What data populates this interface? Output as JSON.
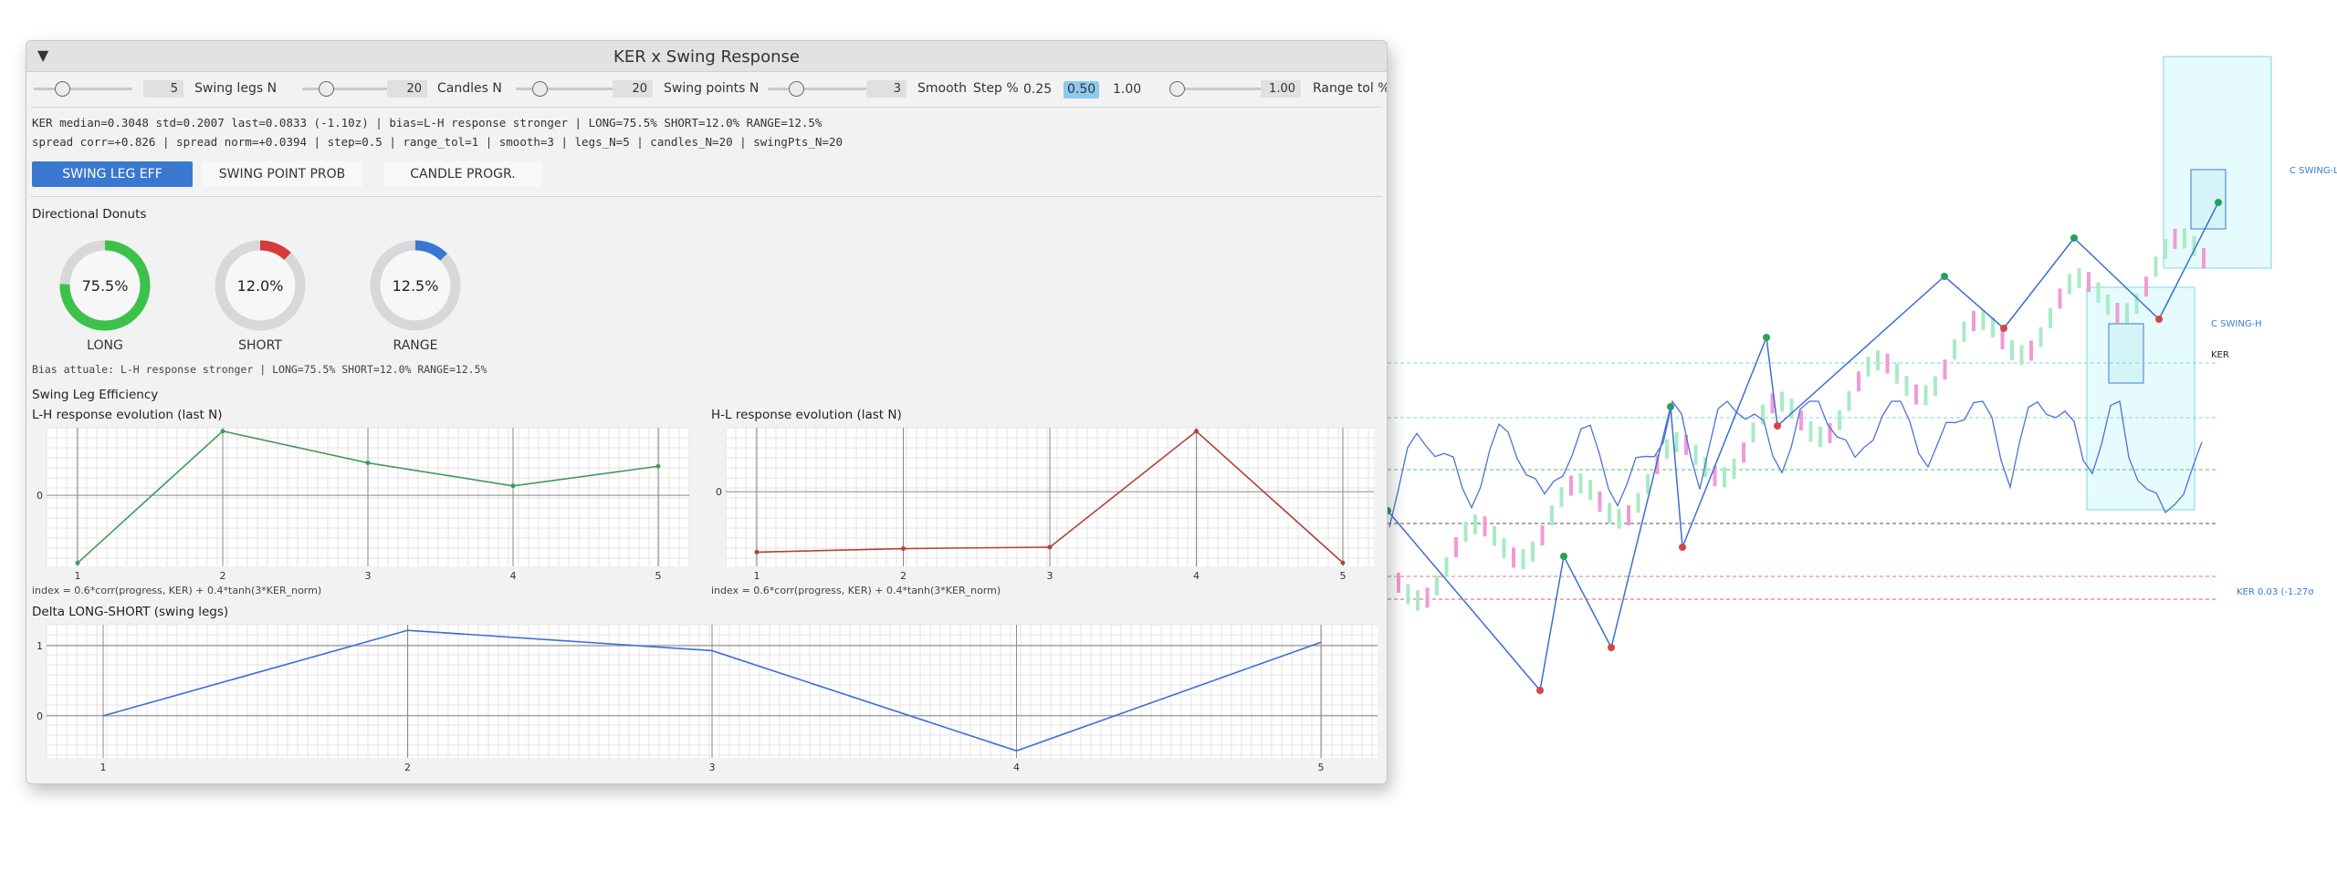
{
  "window": {
    "title": "KER x Swing Response",
    "collapse_icon": "▼"
  },
  "controls": {
    "swing_legs": {
      "value": "5",
      "label": "Swing legs N",
      "slider_pos": 0.25
    },
    "candles": {
      "value": "20",
      "label": "Candles N",
      "slider_pos": 0.2
    },
    "swing_points": {
      "value": "20",
      "label": "Swing points N",
      "slider_pos": 0.2
    },
    "smooth": {
      "value": "3",
      "label": "Smooth",
      "slider_pos": 0.25
    },
    "step": {
      "label": "Step %",
      "options": [
        "0.25",
        "0.50",
        "1.00"
      ],
      "selected": "0.50"
    },
    "range_tol": {
      "value": "1.00",
      "label": "Range tol %",
      "slider_pos": 0.0
    }
  },
  "stats": {
    "line1": "KER median=0.3048 std=0.2007 last=0.0833 (-1.10z) | bias=L-H response stronger | LONG=75.5% SHORT=12.0% RANGE=12.5%",
    "line2": "spread corr=+0.826 | spread norm=+0.0394 | step=0.5 | range_tol=1 | smooth=3 | legs_N=5 | candles_N=20 | swingPts_N=20"
  },
  "tabs": [
    {
      "label": "SWING LEG EFF",
      "active": true
    },
    {
      "label": "SWING POINT PROB",
      "active": false
    },
    {
      "label": "CANDLE PROGR.",
      "active": false
    }
  ],
  "donuts": {
    "title": "Directional Donuts",
    "items": [
      {
        "label": "LONG",
        "value": 75.5,
        "text": "75.5%",
        "color": "#3cc24a"
      },
      {
        "label": "SHORT",
        "value": 12.0,
        "text": "12.0%",
        "color": "#d63a3a"
      },
      {
        "label": "RANGE",
        "value": 12.5,
        "text": "12.5%",
        "color": "#3a78d0"
      }
    ],
    "bias_text": "Bias attuale: L-H response stronger | LONG=75.5% SHORT=12.0% RANGE=12.5%"
  },
  "section_title": "Swing Leg Efficiency",
  "chart_data": [
    {
      "type": "line",
      "title": "L-H response evolution (last N)",
      "x": [
        1,
        2,
        3,
        4,
        5
      ],
      "series": [
        {
          "values": [
            -1.0,
            0.95,
            0.48,
            0.14,
            0.43
          ],
          "color": "#3f9a55"
        }
      ],
      "ylim": [
        -1.05,
        1.0
      ],
      "zero_label": "0",
      "footnote": "index = 0.6*corr(progress, KER) + 0.4*tanh(3*KER_norm)"
    },
    {
      "type": "line",
      "title": "H-L response evolution (last N)",
      "x": [
        1,
        2,
        3,
        4,
        5
      ],
      "series": [
        {
          "values": [
            -0.85,
            -0.8,
            -0.78,
            0.85,
            -1.0
          ],
          "color": "#b34236"
        }
      ],
      "ylim": [
        -1.05,
        0.9
      ],
      "zero_label": "0",
      "footnote": "index = 0.6*corr(progress, KER) + 0.4*tanh(3*KER_norm)"
    },
    {
      "type": "line",
      "title": "Delta LONG-SHORT (swing legs)",
      "x": [
        1,
        2,
        3,
        4,
        5
      ],
      "series": [
        {
          "values": [
            0.0,
            1.22,
            0.93,
            -0.5,
            1.05
          ],
          "color": "#3a6fd0"
        }
      ],
      "ylim": [
        -0.6,
        1.3
      ],
      "y_ticks": [
        "1",
        "0"
      ]
    }
  ],
  "background": {
    "labels": {
      "swing_l": "C SWING-L",
      "swing_h": "C SWING-H",
      "ker": "KER",
      "ker_readout": "KER 0.03 (-1.27σ"
    }
  }
}
